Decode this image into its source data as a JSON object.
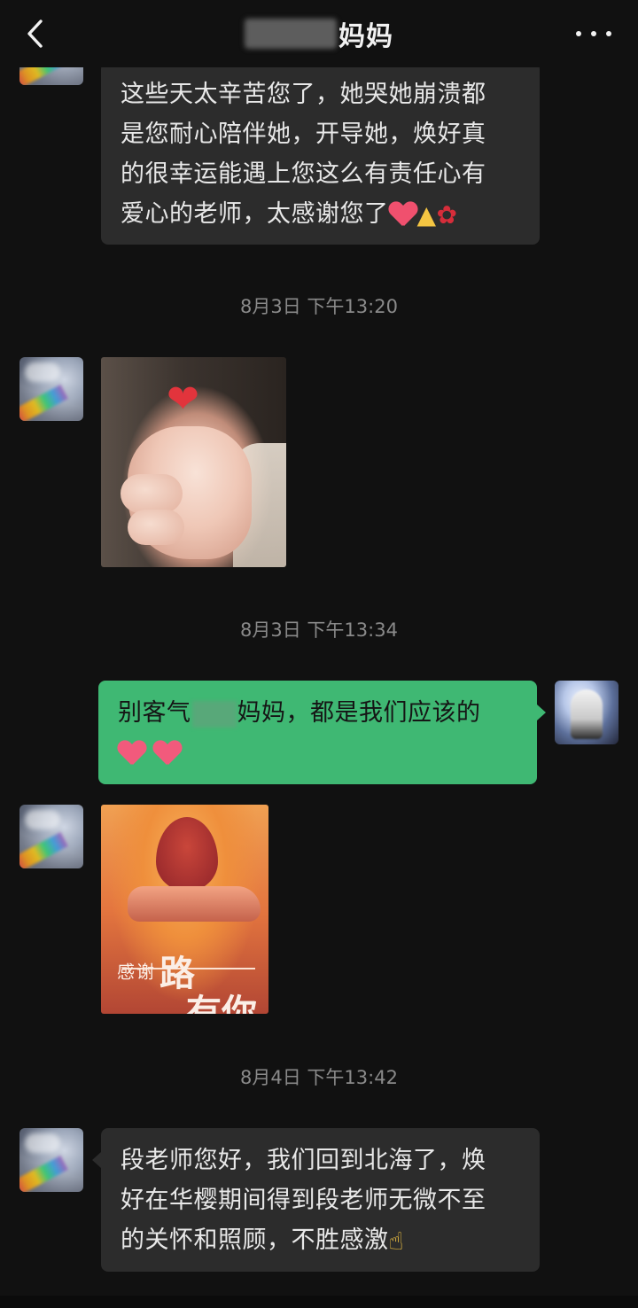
{
  "header": {
    "title": "妈妈",
    "back_icon": "chevron-left-icon",
    "more_icon": "more-horizontal-icon"
  },
  "messages": [
    {
      "type": "text",
      "direction": "in",
      "lines": [
        "这些天太辛苦您了，她哭她崩溃都",
        "是您耐心陪伴她，开导她，焕好真",
        "的很幸运能遇上您这么有责任心有",
        "爱心的老师，太感谢您了"
      ],
      "emojis": [
        "red-heart",
        "thumbs-up",
        "rose"
      ]
    },
    {
      "type": "timestamp",
      "text": "8月3日 下午13:20"
    },
    {
      "type": "image",
      "direction": "in",
      "description_icon": "baby-fist-heart-photo"
    },
    {
      "type": "timestamp",
      "text": "8月3日 下午13:34"
    },
    {
      "type": "text",
      "direction": "out",
      "line1_prefix": "别客气",
      "line1_suffix": "妈妈，都是我们应该的",
      "emojis": [
        "red-heart",
        "red-heart"
      ]
    },
    {
      "type": "image",
      "direction": "in",
      "card_small_text": "感谢",
      "card_big_text_1": "路",
      "card_big_text_2": "有你"
    },
    {
      "type": "timestamp",
      "text": "8月4日 下午13:42"
    },
    {
      "type": "text",
      "direction": "in",
      "lines": [
        "段老师您好，我们回到北海了，焕",
        "好在华樱期间得到段老师无微不至",
        "的关怀和照顾，不胜感激"
      ],
      "emojis": [
        "folded-hands"
      ]
    }
  ],
  "colors": {
    "background": "#111111",
    "bubble_in": "#2c2c2c",
    "bubble_out": "#3fb873",
    "timestamp": "#8a8a8a"
  }
}
